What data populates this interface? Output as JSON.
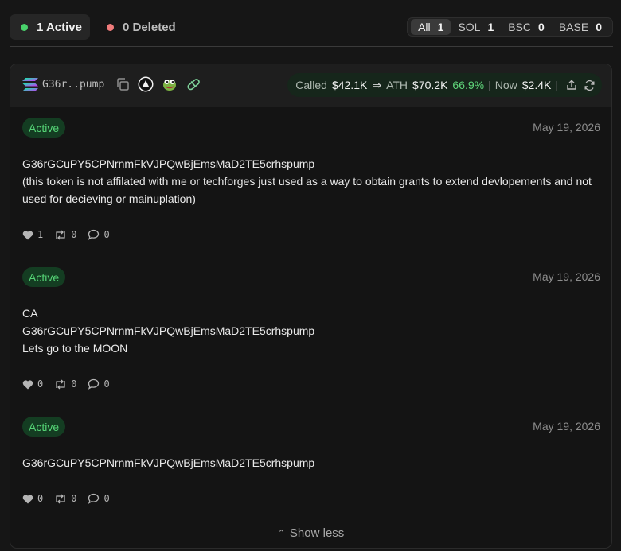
{
  "filters": {
    "active_label": "1 Active",
    "deleted_label": "0 Deleted"
  },
  "chains": [
    {
      "label": "All",
      "count": "1"
    },
    {
      "label": "SOL",
      "count": "1"
    },
    {
      "label": "BSC",
      "count": "0"
    },
    {
      "label": "BASE",
      "count": "0"
    }
  ],
  "token": {
    "short_address": "G36r..pump",
    "icons": [
      "solana-icon",
      "copy-icon",
      "platform-icon",
      "pepe-icon",
      "pill-icon"
    ]
  },
  "stats": {
    "called_label": "Called",
    "called_value": "$42.1K",
    "ath_label": "ATH",
    "ath_value": "$70.2K",
    "ath_pct": "66.9%",
    "now_label": "Now",
    "now_value": "$2.4K"
  },
  "posts": [
    {
      "status": "Active",
      "date": "May 19, 2026",
      "lines": [
        "G36rGCuPY5CPNrnmFkVJPQwBjEmsMaD2TE5crhspump",
        "(this token is not affilated with me or techforges just used as a way to obtain grants to extend devlopements and not used for decieving or mainuplation)"
      ],
      "likes": "1",
      "reposts": "0",
      "replies": "0"
    },
    {
      "status": "Active",
      "date": "May 19, 2026",
      "lines": [
        "CA",
        "G36rGCuPY5CPNrnmFkVJPQwBjEmsMaD2TE5crhspump",
        "Lets go to the MOON"
      ],
      "likes": "0",
      "reposts": "0",
      "replies": "0"
    },
    {
      "status": "Active",
      "date": "May 19, 2026",
      "lines": [
        "G36rGCuPY5CPNrnmFkVJPQwBjEmsMaD2TE5crhspump"
      ],
      "likes": "0",
      "reposts": "0",
      "replies": "0"
    }
  ],
  "show_less_label": "Show less",
  "colors": {
    "accent_green": "#49d16b",
    "deleted_red": "#f07b7b",
    "badge_bg": "#143d22"
  }
}
